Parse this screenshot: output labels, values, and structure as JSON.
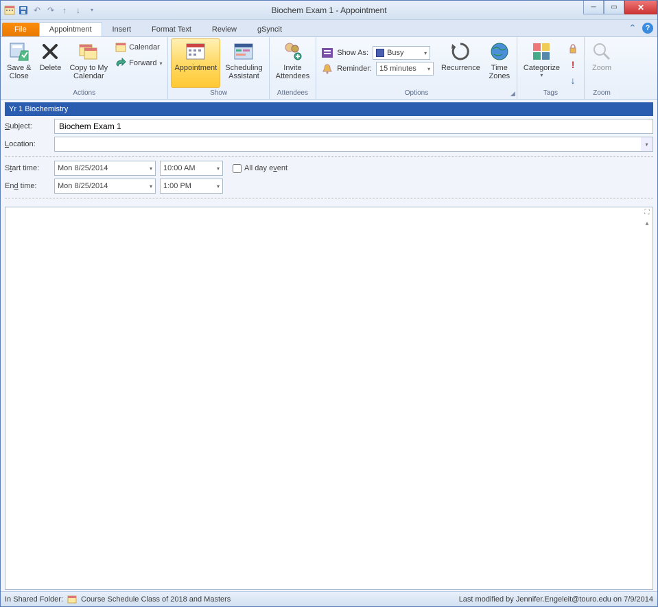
{
  "window": {
    "title": "Biochem Exam 1  -  Appointment"
  },
  "tabs": {
    "file": "File",
    "items": [
      "Appointment",
      "Insert",
      "Format Text",
      "Review",
      "gSyncit"
    ],
    "active": 0
  },
  "ribbon": {
    "actions": {
      "label": "Actions",
      "save_close": "Save &\nClose",
      "delete": "Delete",
      "copy_cal": "Copy to My\nCalendar",
      "calendar": "Calendar",
      "forward": "Forward"
    },
    "show": {
      "label": "Show",
      "appointment": "Appointment",
      "scheduling": "Scheduling\nAssistant"
    },
    "attendees": {
      "label": "Attendees",
      "invite": "Invite\nAttendees"
    },
    "options": {
      "label": "Options",
      "show_as": "Show As:",
      "busy": "Busy",
      "reminder": "Reminder:",
      "reminder_val": "15 minutes",
      "recurrence": "Recurrence",
      "time_zones": "Time\nZones"
    },
    "tags": {
      "label": "Tags",
      "categorize": "Categorize"
    },
    "zoom": {
      "label": "Zoom",
      "zoom": "Zoom"
    }
  },
  "form": {
    "banner": "Yr 1 Biochemistry",
    "subject_label": "Subject:",
    "subject_value": "Biochem Exam 1",
    "location_label": "Location:",
    "location_value": "",
    "start_label": "Start time:",
    "start_date": "Mon 8/25/2014",
    "start_time": "10:00 AM",
    "end_label": "End time:",
    "end_date": "Mon 8/25/2014",
    "end_time": "1:00 PM",
    "all_day": "All day event",
    "body": ""
  },
  "status": {
    "folder_label": "In Shared Folder:",
    "folder_name": "Course Schedule Class of 2018 and Masters",
    "modified": "Last modified by Jennifer.Engeleit@touro.edu on 7/9/2014"
  }
}
